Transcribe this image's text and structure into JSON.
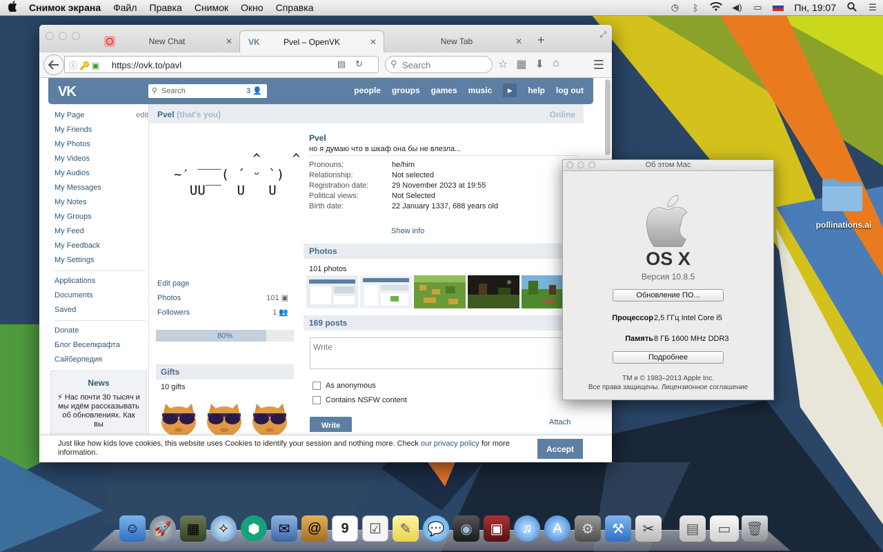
{
  "menubar": {
    "app_name": "Снимок экрана",
    "menus": [
      "Файл",
      "Правка",
      "Снимок",
      "Окно",
      "Справка"
    ],
    "clock": "Пн, 19:07"
  },
  "browser": {
    "tabs": [
      {
        "label": "New Chat"
      },
      {
        "label": "Pvel – OpenVK"
      },
      {
        "label": "New Tab"
      }
    ],
    "url": "https://ovk.to/pavl",
    "search_placeholder": "Search"
  },
  "vk": {
    "search_placeholder": "Search",
    "search_count": "3",
    "nav": [
      "people",
      "groups",
      "games",
      "music",
      "help",
      "log out"
    ],
    "left_menu": [
      "My Page",
      "My Friends",
      "My Photos",
      "My Videos",
      "My Audios",
      "My Messages",
      "My Notes",
      "My Groups",
      "My Feed",
      "My Feedback",
      "My Settings"
    ],
    "edit_label": "edit",
    "left_menu2": [
      "Applications",
      "Documents",
      "Saved"
    ],
    "left_menu3": [
      "Donate",
      "Блог Веселкрафта",
      "Сайберпедия"
    ],
    "news_title": "News",
    "news_text": "⚡ Нас почти 30 тысяч и мы идём рассказывать об обновлениях. Как вы",
    "page_name": "Pvel",
    "page_you": "(that's you)",
    "online": "Online",
    "ascii_art": "          ^    ^\n~′ ‾‾‾( ´ ᵕ `)\n  UU‾‾  U   U",
    "edit_page": "Edit page",
    "photos_label": "Photos",
    "photos_count": "101",
    "followers_label": "Followers",
    "followers_count": "1",
    "completion": "80%",
    "completion_value": 80,
    "gifts_title": "Gifts",
    "gifts_count": "10 gifts",
    "profile_name": "Pvel",
    "profile_status": "но я думаю что в шкаф она бы не влезла...",
    "info": [
      {
        "k": "Pronouns:",
        "v": "he/him"
      },
      {
        "k": "Relationship:",
        "v": "Not selected"
      },
      {
        "k": "Registration date:",
        "v": "29 November 2023 at 19:55"
      },
      {
        "k": "Political views:",
        "v": "Not Selected"
      },
      {
        "k": "Birth date:",
        "v": "22 January 1337, 688 years old"
      }
    ],
    "show_info": "Show info",
    "photos_title": "Photos",
    "photos_total": "101 photos",
    "posts_title": "169 posts",
    "write_placeholder": "Write",
    "anonymous": "As anonymous",
    "nsfw": "Contains NSFW content",
    "write_button": "Write",
    "attach": "Attach",
    "cookie_text": "Just like how kids love cookies, this website uses Cookies to identify your session and nothing more. Check",
    "cookie_link": "our privacy policy",
    "cookie_tail": "for more information.",
    "accept": "Accept"
  },
  "about": {
    "title": "Об этом Mac",
    "os": "OS X",
    "version": "Версия 10.8.5",
    "update_button": "Обновление ПО...",
    "processor_label": "Процессор",
    "processor": "2,5 ГГц Intel Core i5",
    "memory_label": "Память",
    "memory": "8 ГБ 1600 MHz DDR3",
    "more_button": "Подробнее",
    "copyright1": "TM и © 1983–2013 Apple Inc.",
    "copyright2": "Все права защищены. Лицензионное соглашение"
  },
  "desktop": {
    "folder_label": "pollinations.ai"
  },
  "colors": {
    "vk_blue": "#5d7fa3",
    "vk_link": "#2b587a",
    "desktop": "#22405e"
  }
}
